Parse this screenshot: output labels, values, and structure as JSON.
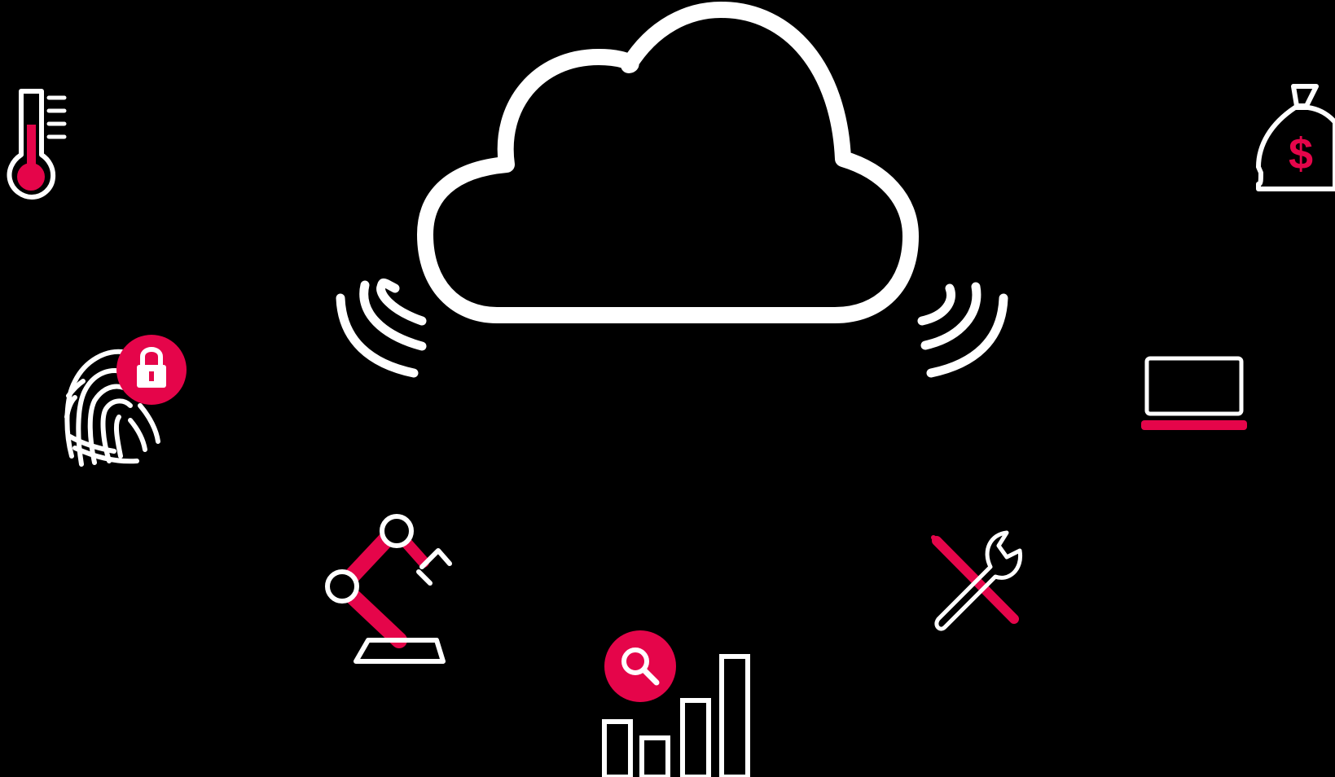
{
  "colors": {
    "background": "#000000",
    "line": "#ffffff",
    "accent": "#e5054a"
  },
  "icons": [
    "cloud-icon",
    "wifi-waves-left-icon",
    "wifi-waves-right-icon",
    "thermometer-icon",
    "money-bag-icon",
    "dollar-icon",
    "fingerprint-icon",
    "lock-icon",
    "laptop-icon",
    "robot-arm-icon",
    "tools-icon",
    "bar-chart-icon",
    "magnifier-icon"
  ],
  "money_bag": {
    "symbol": "$"
  },
  "thermometer": {
    "level": 0.55
  }
}
